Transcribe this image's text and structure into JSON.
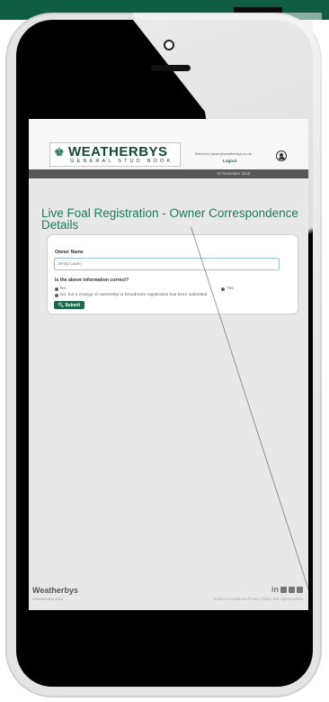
{
  "header": {
    "logo_name": "WEATHERBYS",
    "logo_sub": "GENERAL STUD BOOK",
    "welcome": "Welcome jdean@weatherbys.co.uk",
    "logout": "Logout"
  },
  "date_bar": "07 November 2016",
  "page_title": "Live Foal Registration - Owner Correspondence Details",
  "form": {
    "owner_label": "Owner Name",
    "owner_value": "Jenny Lane |",
    "question": "Is the above information correct?",
    "options": [
      "No",
      "Yes",
      "No, but a change of ownership or broodmare registration has been submitted"
    ],
    "submit_label": "Submit"
  },
  "footer": {
    "name": "Weatherbys",
    "copyright": "©Weatherbys 2016",
    "links": "Terms & Conditions  Privacy Policy  Job Opportunities",
    "social": "in"
  }
}
